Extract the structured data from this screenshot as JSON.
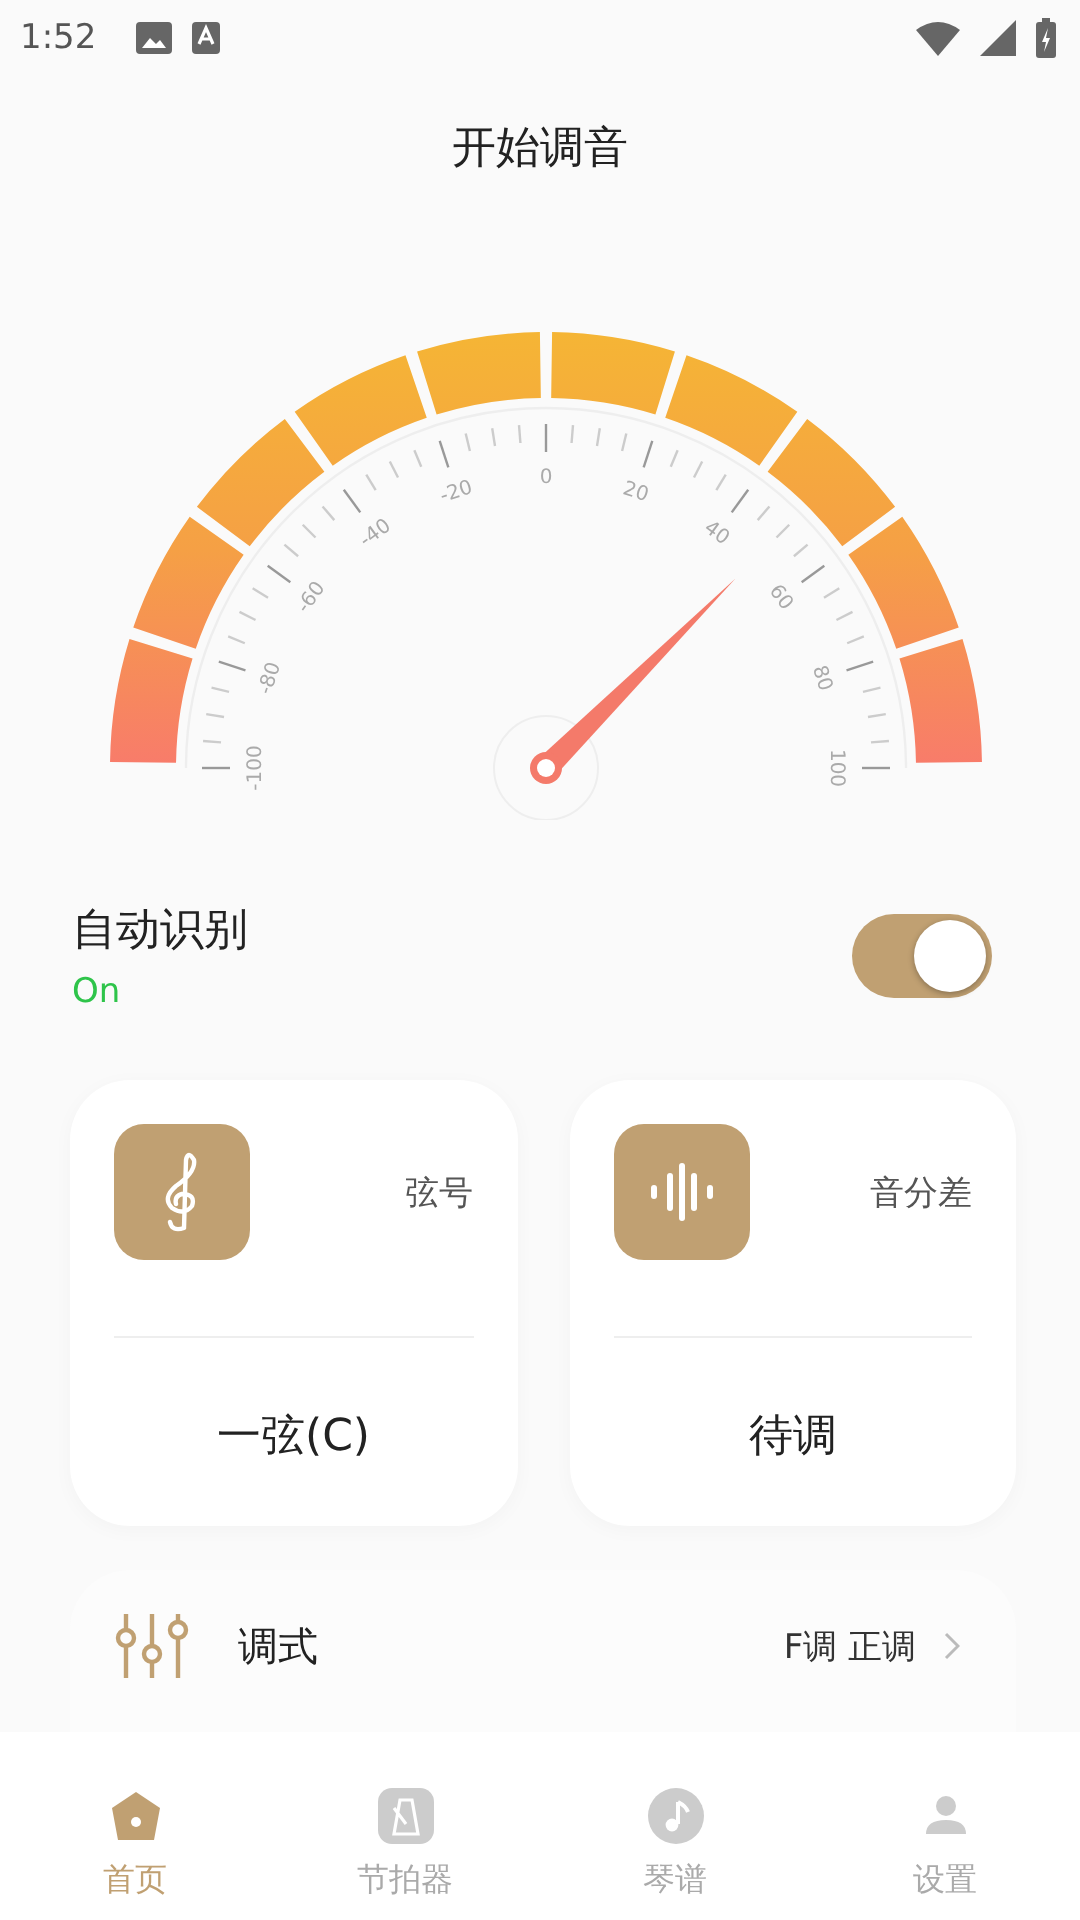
{
  "status_bar": {
    "time": "1:52"
  },
  "title": "开始调音",
  "gauge": {
    "scale_labels": [
      "-100",
      "-80",
      "-60",
      "-40",
      "-20",
      "0",
      "20",
      "40",
      "60",
      "80",
      "100"
    ]
  },
  "auto_detect": {
    "label": "自动识别",
    "status": "On",
    "on": true
  },
  "cards": [
    {
      "kind": "clef",
      "label": "弦号",
      "value": "一弦(C)"
    },
    {
      "kind": "wave",
      "label": "音分差",
      "value": "待调"
    }
  ],
  "mode_row": {
    "label": "调式",
    "value": "F调 正调"
  },
  "nav": [
    {
      "kind": "home",
      "label": "首页",
      "selected": true
    },
    {
      "kind": "metronome",
      "label": "节拍器",
      "selected": false
    },
    {
      "kind": "note",
      "label": "琴谱",
      "selected": false
    },
    {
      "kind": "person",
      "label": "设置",
      "selected": false
    }
  ]
}
